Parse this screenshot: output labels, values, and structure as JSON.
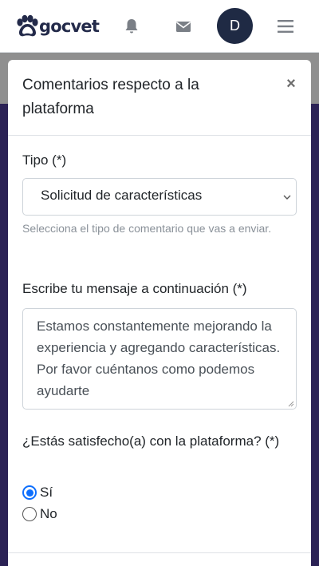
{
  "brand": {
    "name": "gocvet"
  },
  "navbar": {
    "icons": [
      "paw-icon",
      "bell-icon",
      "mail-icon",
      "menu-icon"
    ],
    "avatar_initial": "D",
    "avatar_color": "#1f2a44"
  },
  "modal": {
    "title": "Comentarios respecto a la plataforma",
    "close_label": "×",
    "tipo": {
      "label": "Tipo (*)",
      "selected": "Solicitud de características",
      "help": "Selecciona el tipo de comentario que vas a enviar."
    },
    "mensaje": {
      "label": "Escribe tu mensaje a continuación (*)",
      "placeholder": "Estamos constantemente mejorando la experiencia y agregando características. Por favor cuéntanos como podemos ayudarte"
    },
    "satisfaccion": {
      "label": "¿Estás satisfecho(a) con la plataforma? (*)",
      "options": [
        {
          "label": "Sí",
          "checked": true
        },
        {
          "label": "No",
          "checked": false
        }
      ]
    }
  },
  "colors": {
    "accent": "#0d6efd",
    "brand_dark": "#232a4a",
    "backdrop": "#2b2255"
  }
}
